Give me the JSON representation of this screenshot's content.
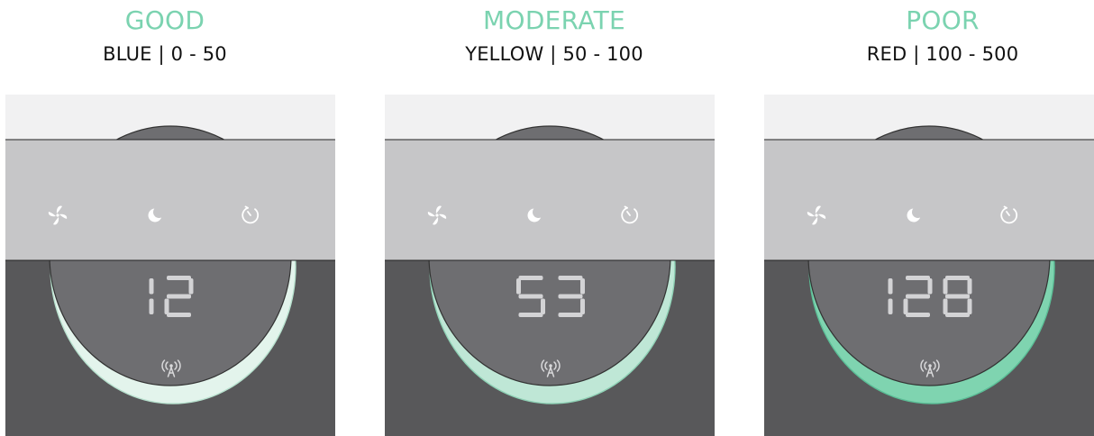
{
  "panels": [
    {
      "level": "GOOD",
      "range": "BLUE | 0 - 50",
      "reading": "12",
      "ring_color": "#e3f4ec",
      "ring_stroke": "#b8e2cf"
    },
    {
      "level": "MODERATE",
      "range": "YELLOW | 50 - 100",
      "reading": "53",
      "ring_color": "#bfe7d6",
      "ring_stroke": "#8fd2b6"
    },
    {
      "level": "POOR",
      "range": "RED | 100 - 500",
      "reading": "128",
      "ring_color": "#7fd4b0",
      "ring_stroke": "#5bbf97"
    }
  ],
  "icons": {
    "fan": "fan-icon",
    "sleep": "moon-icon",
    "timer": "timer-icon",
    "wifi": "wifi-signal-icon"
  },
  "colors": {
    "accent": "#7bd3b0",
    "panel_light": "#c6c6c8",
    "panel_dark": "#58585a",
    "display": "#6e6e71",
    "segment": "#d3d3d5"
  }
}
